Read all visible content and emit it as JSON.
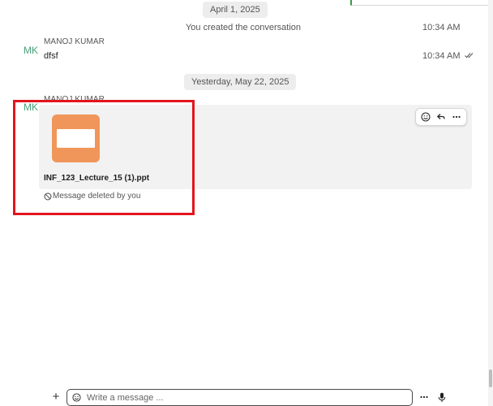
{
  "conversation": {
    "date_1": "April 1, 2025",
    "system_message": "You created the conversation",
    "system_time": "10:34 AM",
    "message_1": {
      "avatar_initials": "MK",
      "sender": "MANOJ KUMAR",
      "text": "dfsf",
      "time": "10:34 AM"
    },
    "date_2": "Yesterday, May 22, 2025",
    "message_2": {
      "avatar_initials": "MK",
      "sender": "MANOJ KUMAR",
      "file_name": "INF_123_Lecture_15 (1).ppt",
      "deleted_note": "Message deleted by you"
    }
  },
  "reaction_bar": {
    "icons": [
      "emoji-icon",
      "reply-icon",
      "more-options-icon"
    ]
  },
  "composer": {
    "placeholder": "Write a message ..."
  },
  "colors": {
    "avatar": "#49a07a",
    "file_thumb": "#f0965a",
    "highlight": "#e2151d",
    "bubble": "#f2f2f2"
  }
}
